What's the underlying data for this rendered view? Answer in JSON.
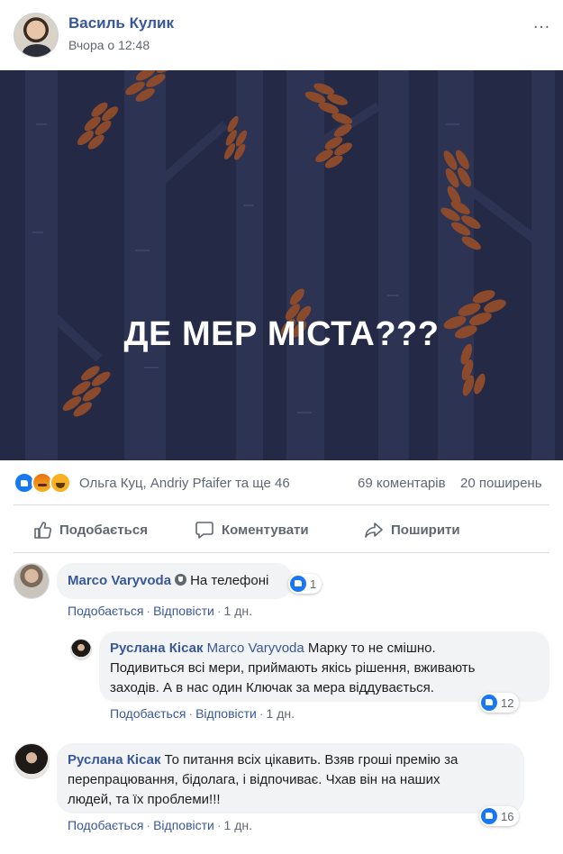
{
  "post": {
    "author": "Василь Кулик",
    "time": "Вчора о 12:48",
    "more_icon": "…",
    "image_text": "ДЕ МЕР МІСТА???",
    "reactors": "Ольга Куц, Andriy Pfaifer та ще 46",
    "comments_count": "69 коментарів",
    "shares_count": "20 поширень"
  },
  "actions": {
    "like": "Подобається",
    "comment": "Коментувати",
    "share": "Поширити"
  },
  "comments": [
    {
      "name": "Marco Varyvoda",
      "text": "На телефоні",
      "like_label": "Подобається",
      "reply_label": "Відповісти",
      "time": "1 дн.",
      "likes": "1"
    },
    {
      "name": "Руслана Кісак",
      "reply_to": "Marco Varyvoda",
      "lines": [
        "Марку то не смішно.",
        "Подивиться всі мери, приймають якісь рішення, вживають",
        "заходів. А в нас один Ключак за мера віддувається."
      ],
      "like_label": "Подобається",
      "reply_label": "Відповісти",
      "time": "1 дн.",
      "likes": "12"
    },
    {
      "name": "Руслана Кісак",
      "lines": [
        "То питання всіх цікавить. Взяв гроші премію за",
        "перепрацювання, бідолага, і відпочиває. Чхав він на наших",
        "людей, та їх проблеми!!!"
      ],
      "like_label": "Подобається",
      "reply_label": "Відповісти",
      "time": "1 дн.",
      "likes": "16"
    }
  ],
  "colors": {
    "link": "#385898",
    "image_bg": "#242a45",
    "leaf": "#8b4a2b",
    "like_blue": "#1877f2"
  }
}
